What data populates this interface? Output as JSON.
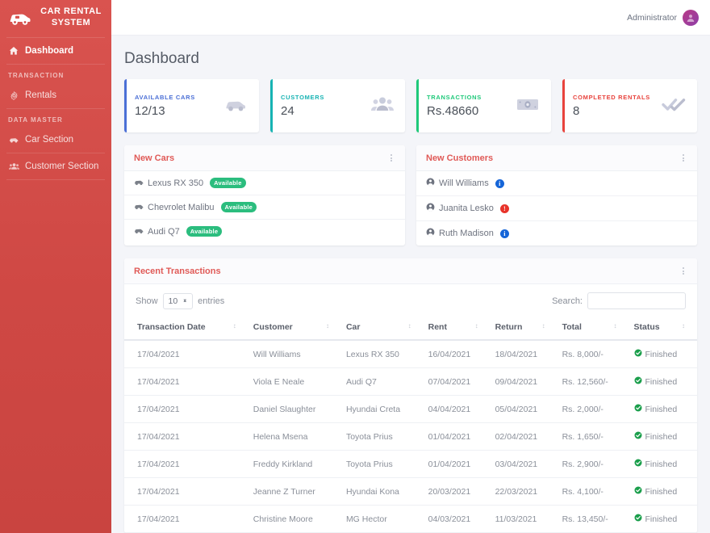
{
  "sidebar": {
    "brand": {
      "title": "CAR RENTAL SYSTEM",
      "icon": "car-icon"
    },
    "items": [
      {
        "label": "Dashboard",
        "icon": "home-icon",
        "active": true
      },
      {
        "label": "Rentals",
        "icon": "gear-icon",
        "active": false
      },
      {
        "label": "Car Section",
        "icon": "car-icon",
        "active": false
      },
      {
        "label": "Customer Section",
        "icon": "users-icon",
        "active": false
      }
    ],
    "sections": {
      "transaction": "TRANSACTION",
      "data_master": "DATA MASTER"
    }
  },
  "topbar": {
    "user": "Administrator",
    "avatar_icon": "user-avatar-icon"
  },
  "page": {
    "title": "Dashboard"
  },
  "stats": [
    {
      "label": "AVAILABLE CARS",
      "value": "12/13",
      "color": "#4b6fd6",
      "icon": "car-icon"
    },
    {
      "label": "CUSTOMERS",
      "value": "24",
      "color": "#17b3b3",
      "icon": "users-icon"
    },
    {
      "label": "TRANSACTIONS",
      "value": "Rs.48660",
      "color": "#1fc97a",
      "icon": "money-icon"
    },
    {
      "label": "COMPLETED RENTALS",
      "value": "8",
      "color": "#e8433d",
      "icon": "double-check-icon"
    }
  ],
  "new_cars": {
    "title": "New Cars",
    "menu_icon": "more-vertical-icon",
    "items": [
      {
        "name": "Lexus RX 350",
        "status": "Available"
      },
      {
        "name": "Chevrolet Malibu",
        "status": "Available"
      },
      {
        "name": "Audi Q7",
        "status": "Available"
      }
    ]
  },
  "new_customers": {
    "title": "New Customers",
    "menu_icon": "more-vertical-icon",
    "items": [
      {
        "name": "Will Williams",
        "badge": "i",
        "badge_color": "#1565d8"
      },
      {
        "name": "Juanita Lesko",
        "badge": "!",
        "badge_color": "#e8332a"
      },
      {
        "name": "Ruth Madison",
        "badge": "i",
        "badge_color": "#1565d8"
      }
    ]
  },
  "transactions": {
    "title": "Recent Transactions",
    "menu_icon": "more-vertical-icon",
    "show_label": "Show",
    "entries_label": "entries",
    "page_size": "10",
    "search_label": "Search:",
    "search_value": "",
    "columns": [
      "Transaction Date",
      "Customer",
      "Car",
      "Rent",
      "Return",
      "Total",
      "Status"
    ],
    "rows": [
      {
        "date": "17/04/2021",
        "customer": "Will Williams",
        "car": "Lexus RX 350",
        "rent": "16/04/2021",
        "return": "18/04/2021",
        "total": "Rs. 8,000/-",
        "status": "Finished"
      },
      {
        "date": "17/04/2021",
        "customer": "Viola E Neale",
        "car": "Audi Q7",
        "rent": "07/04/2021",
        "return": "09/04/2021",
        "total": "Rs. 12,560/-",
        "status": "Finished"
      },
      {
        "date": "17/04/2021",
        "customer": "Daniel Slaughter",
        "car": "Hyundai Creta",
        "rent": "04/04/2021",
        "return": "05/04/2021",
        "total": "Rs. 2,000/-",
        "status": "Finished"
      },
      {
        "date": "17/04/2021",
        "customer": "Helena Msena",
        "car": "Toyota Prius",
        "rent": "01/04/2021",
        "return": "02/04/2021",
        "total": "Rs. 1,650/-",
        "status": "Finished"
      },
      {
        "date": "17/04/2021",
        "customer": "Freddy Kirkland",
        "car": "Toyota Prius",
        "rent": "01/04/2021",
        "return": "03/04/2021",
        "total": "Rs. 2,900/-",
        "status": "Finished"
      },
      {
        "date": "17/04/2021",
        "customer": "Jeanne Z Turner",
        "car": "Hyundai Kona",
        "rent": "20/03/2021",
        "return": "22/03/2021",
        "total": "Rs. 4,100/-",
        "status": "Finished"
      },
      {
        "date": "17/04/2021",
        "customer": "Christine Moore",
        "car": "MG Hector",
        "rent": "04/03/2021",
        "return": "11/03/2021",
        "total": "Rs. 13,450/-",
        "status": "Finished"
      }
    ]
  }
}
